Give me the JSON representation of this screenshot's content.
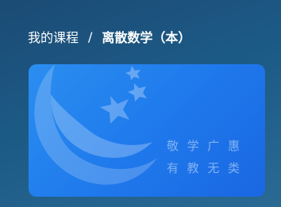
{
  "breadcrumb": {
    "parent": "我的课程",
    "separator": "/",
    "current": "离散数学（本）"
  },
  "card": {
    "motto_line_1": "敬学广惠",
    "motto_line_2": "有教无类",
    "emblem_icon": "university-emblem-icon"
  }
}
